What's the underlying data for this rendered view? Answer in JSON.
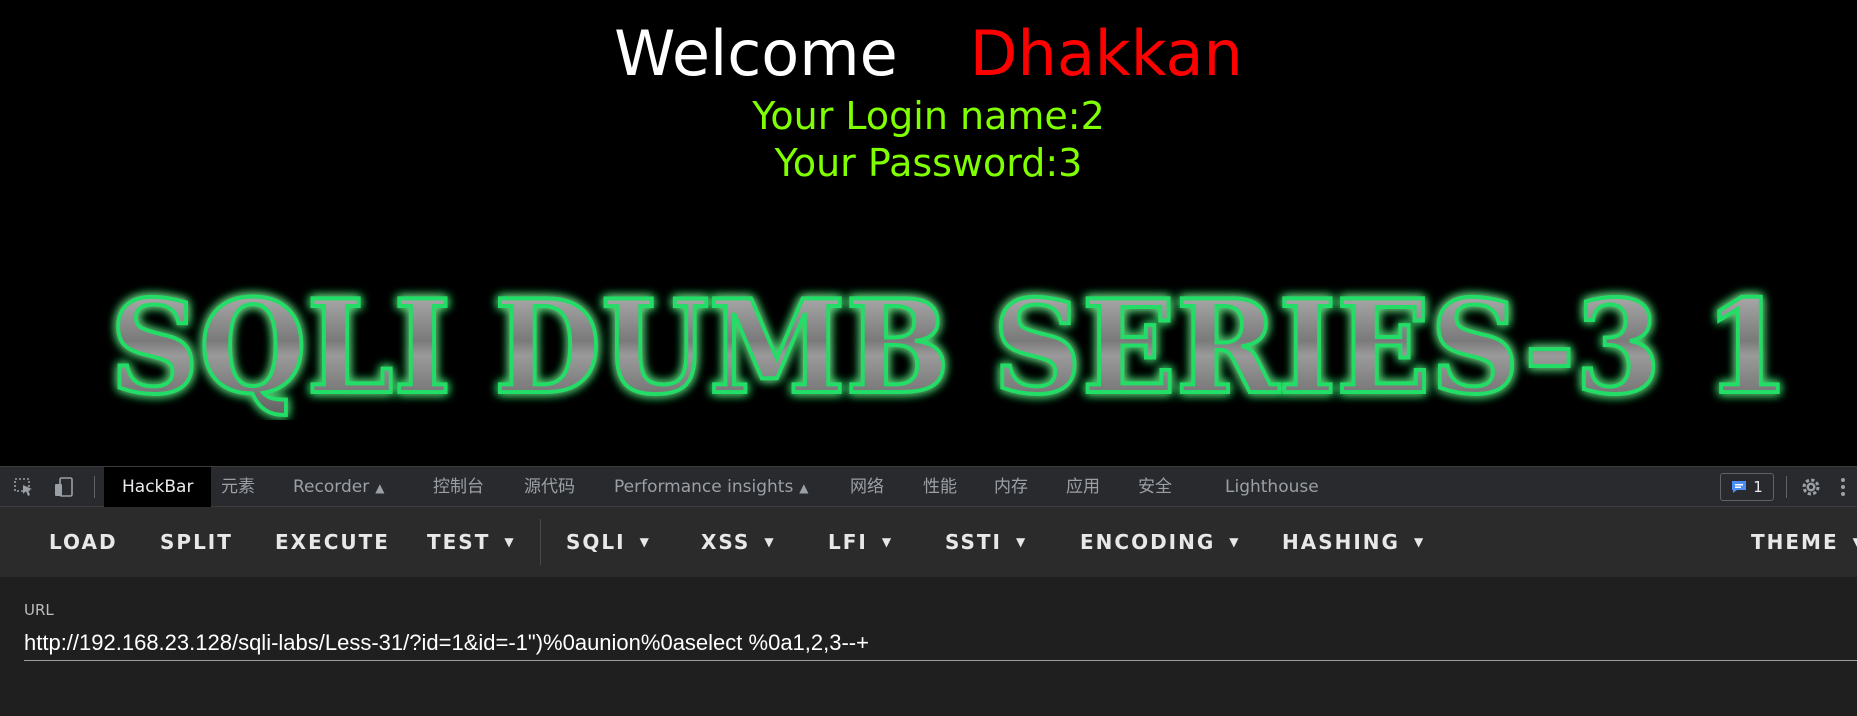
{
  "page": {
    "welcome_word": "Welcome",
    "welcome_name": "Dhakkan",
    "login_line": "Your Login name:2",
    "password_line": "Your Password:3",
    "banner_text": "SQLI DUMB SERIES-3 1",
    "colors": {
      "welcome": "#ffffff",
      "name": "#ff0000",
      "info": "#7fff00",
      "banner_glow": "#22dd66"
    }
  },
  "devtools": {
    "icons": {
      "inspect": "inspect-element-icon",
      "device": "device-toolbar-icon",
      "issues": "issues-icon",
      "settings": "gear-icon",
      "more": "more-vertical-icon"
    },
    "tabs": [
      {
        "label": "HackBar",
        "active": true
      },
      {
        "label": "元素"
      },
      {
        "label": "Recorder",
        "experimental": true
      },
      {
        "label": "控制台"
      },
      {
        "label": "源代码"
      },
      {
        "label": "Performance insights",
        "experimental": true
      },
      {
        "label": "网络"
      },
      {
        "label": "性能"
      },
      {
        "label": "内存"
      },
      {
        "label": "应用"
      },
      {
        "label": "安全"
      },
      {
        "label": "Lighthouse"
      }
    ],
    "issues_count": "1"
  },
  "hackbar": {
    "buttons": [
      {
        "label": "LOAD"
      },
      {
        "label": "SPLIT"
      },
      {
        "label": "EXECUTE"
      },
      {
        "label": "TEST",
        "dropdown": true
      },
      {
        "label": "SQLI",
        "dropdown": true
      },
      {
        "label": "XSS",
        "dropdown": true
      },
      {
        "label": "LFI",
        "dropdown": true
      },
      {
        "label": "SSTI",
        "dropdown": true
      },
      {
        "label": "ENCODING",
        "dropdown": true
      },
      {
        "label": "HASHING",
        "dropdown": true
      },
      {
        "label": "THEME",
        "dropdown": true
      }
    ],
    "url_label": "URL",
    "url_value": "http://192.168.23.128/sqli-labs/Less-31/?id=1&id=-1\")%0aunion%0aselect %0a1,2,3--+"
  }
}
